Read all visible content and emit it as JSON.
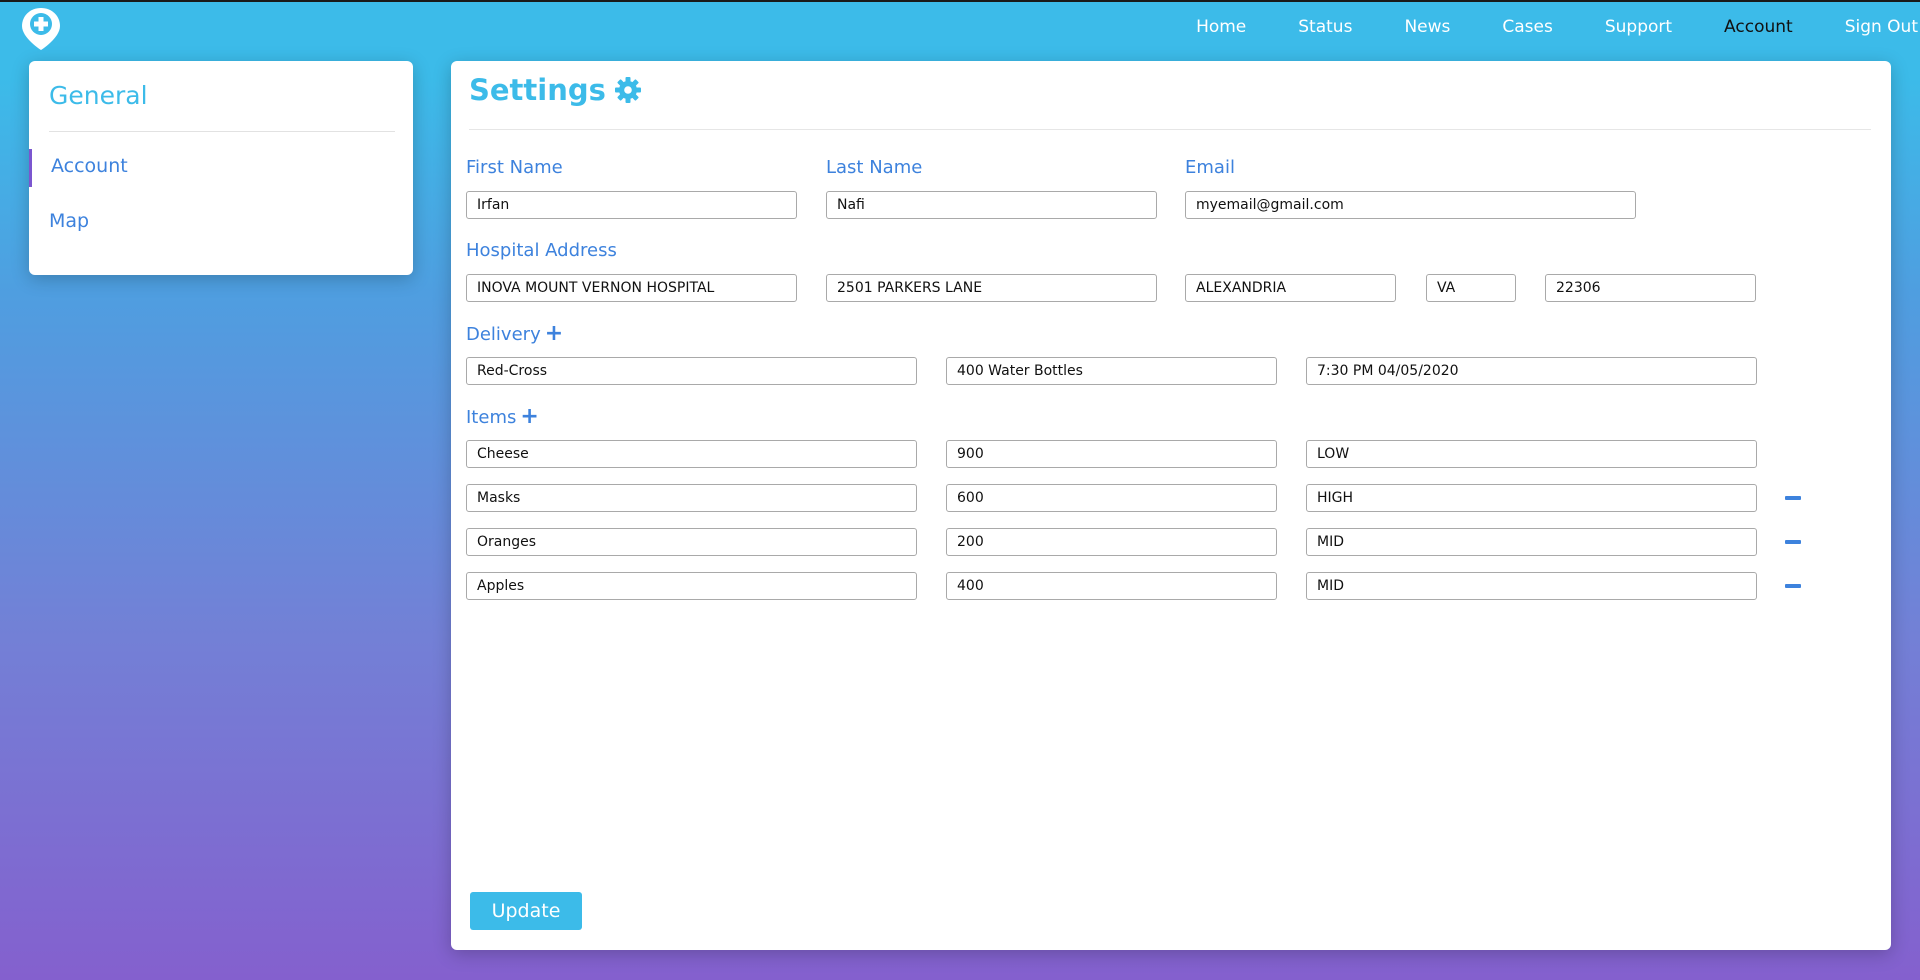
{
  "nav": {
    "items": [
      "Home",
      "Status",
      "News",
      "Cases",
      "Support",
      "Account",
      "Sign Out"
    ],
    "active": "Account"
  },
  "sidebar": {
    "heading": "General",
    "items": [
      {
        "label": "Account"
      },
      {
        "label": "Map"
      }
    ]
  },
  "settings": {
    "title": "Settings",
    "first_name": {
      "label": "First Name",
      "value": "Irfan"
    },
    "last_name": {
      "label": "Last Name",
      "value": "Nafi"
    },
    "email": {
      "label": "Email",
      "value": "myemail@gmail.com"
    },
    "hospital_address": {
      "label": "Hospital Address",
      "name": "INOVA MOUNT VERNON HOSPITAL",
      "street": "2501 PARKERS LANE",
      "city": "ALEXANDRIA",
      "state": "VA",
      "zip": "22306"
    },
    "delivery": {
      "label": "Delivery",
      "provider": "Red-Cross",
      "contents": "400 Water Bottles",
      "time": "7:30 PM 04/05/2020"
    },
    "items": {
      "label": "Items",
      "rows": [
        {
          "name": "Cheese",
          "qty": "900",
          "priority": "LOW"
        },
        {
          "name": "Masks",
          "qty": "600",
          "priority": "HIGH"
        },
        {
          "name": "Oranges",
          "qty": "200",
          "priority": "MID"
        },
        {
          "name": "Apples",
          "qty": "400",
          "priority": "MID"
        }
      ]
    },
    "update_label": "Update"
  },
  "colors": {
    "accent": "#3cbbe9",
    "label_blue": "#3d82dd",
    "active_marker": "#7b56cf",
    "gradient_top": "#3cbbe9",
    "gradient_bottom": "#8460ce"
  }
}
